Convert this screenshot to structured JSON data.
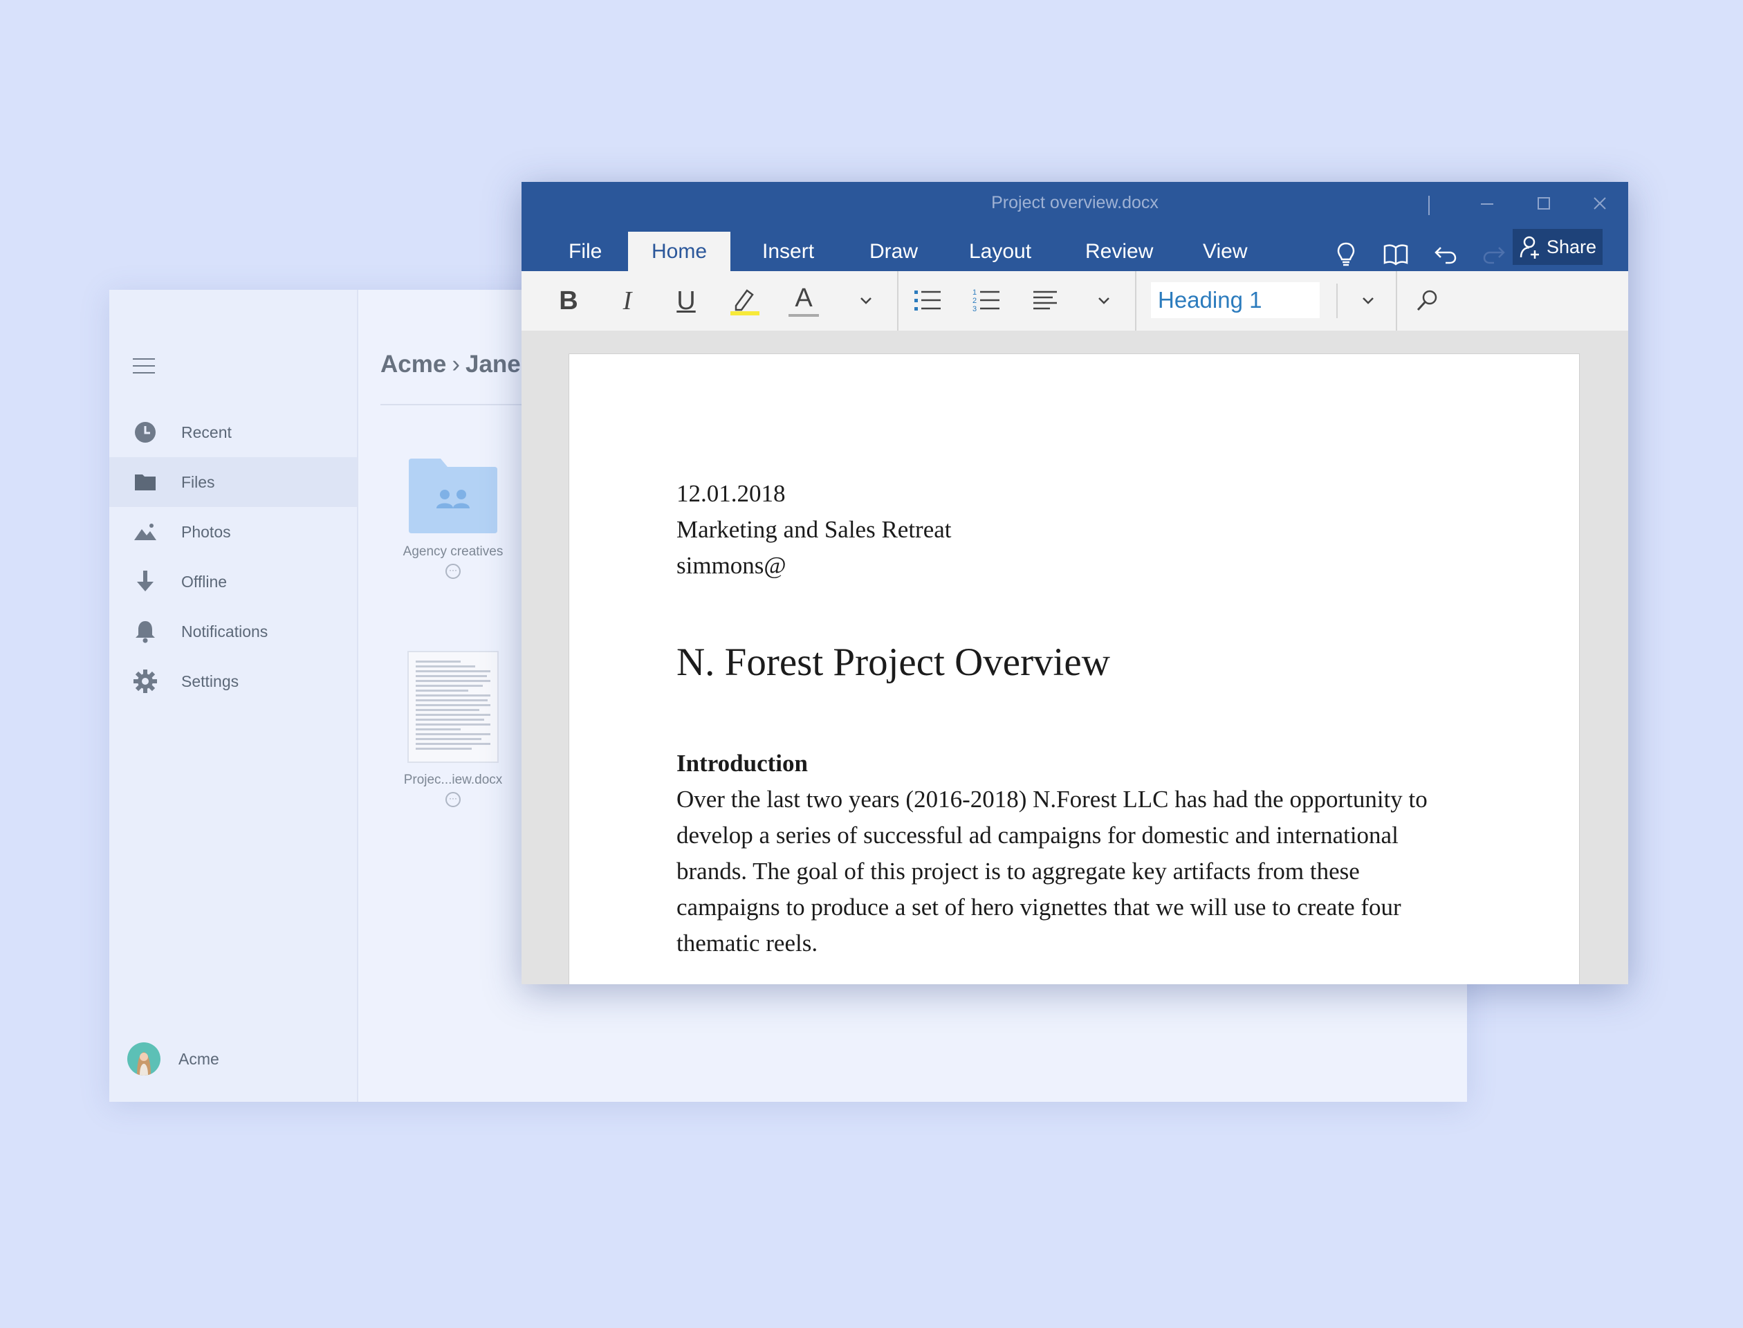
{
  "files_app": {
    "breadcrumb": {
      "root": "Acme",
      "separator": "›",
      "current": "Jane"
    },
    "nav": [
      {
        "label": "Recent",
        "icon": "clock-icon"
      },
      {
        "label": "Files",
        "icon": "folder-icon",
        "active": true
      },
      {
        "label": "Photos",
        "icon": "photos-icon"
      },
      {
        "label": "Offline",
        "icon": "download-icon"
      },
      {
        "label": "Notifications",
        "icon": "bell-icon"
      },
      {
        "label": "Settings",
        "icon": "gear-icon"
      }
    ],
    "user": {
      "name": "Acme"
    },
    "items": [
      {
        "name": "Agency creatives",
        "type": "shared-folder"
      },
      {
        "name": "Projec...iew.docx",
        "type": "document"
      }
    ],
    "more_label": "···"
  },
  "word": {
    "title": "Project overview.docx",
    "tabs": [
      "File",
      "Home",
      "Insert",
      "Draw",
      "Layout",
      "Review",
      "View"
    ],
    "active_tab": "Home",
    "share_label": "Share",
    "toolbar": {
      "bold": "B",
      "italic": "I",
      "underline": "U",
      "font_color": "A",
      "style_value": "Heading 1",
      "highlight_color": "#f7e93a"
    },
    "document": {
      "date": "12.01.2018",
      "event": "Marketing and Sales Retreat",
      "author": "simmons@",
      "heading": "N. Forest Project Overview",
      "section_title": "Introduction",
      "body_lines": [
        "Over the last two years (2016-2018) N.Forest LLC has had the opportunity to",
        "develop a series of successful ad campaigns for domestic and international",
        "brands. The goal of this project is to aggregate key artifacts from these",
        "campaigns to produce a set of hero vignettes that we will use to create four",
        "thematic reels."
      ]
    }
  },
  "colors": {
    "desktop_bg": "#d8e1fb",
    "word_blue": "#2b579a",
    "share_button": "#1e4279",
    "folder_blue": "#b3d2f5",
    "style_text": "#2b7bbd"
  }
}
